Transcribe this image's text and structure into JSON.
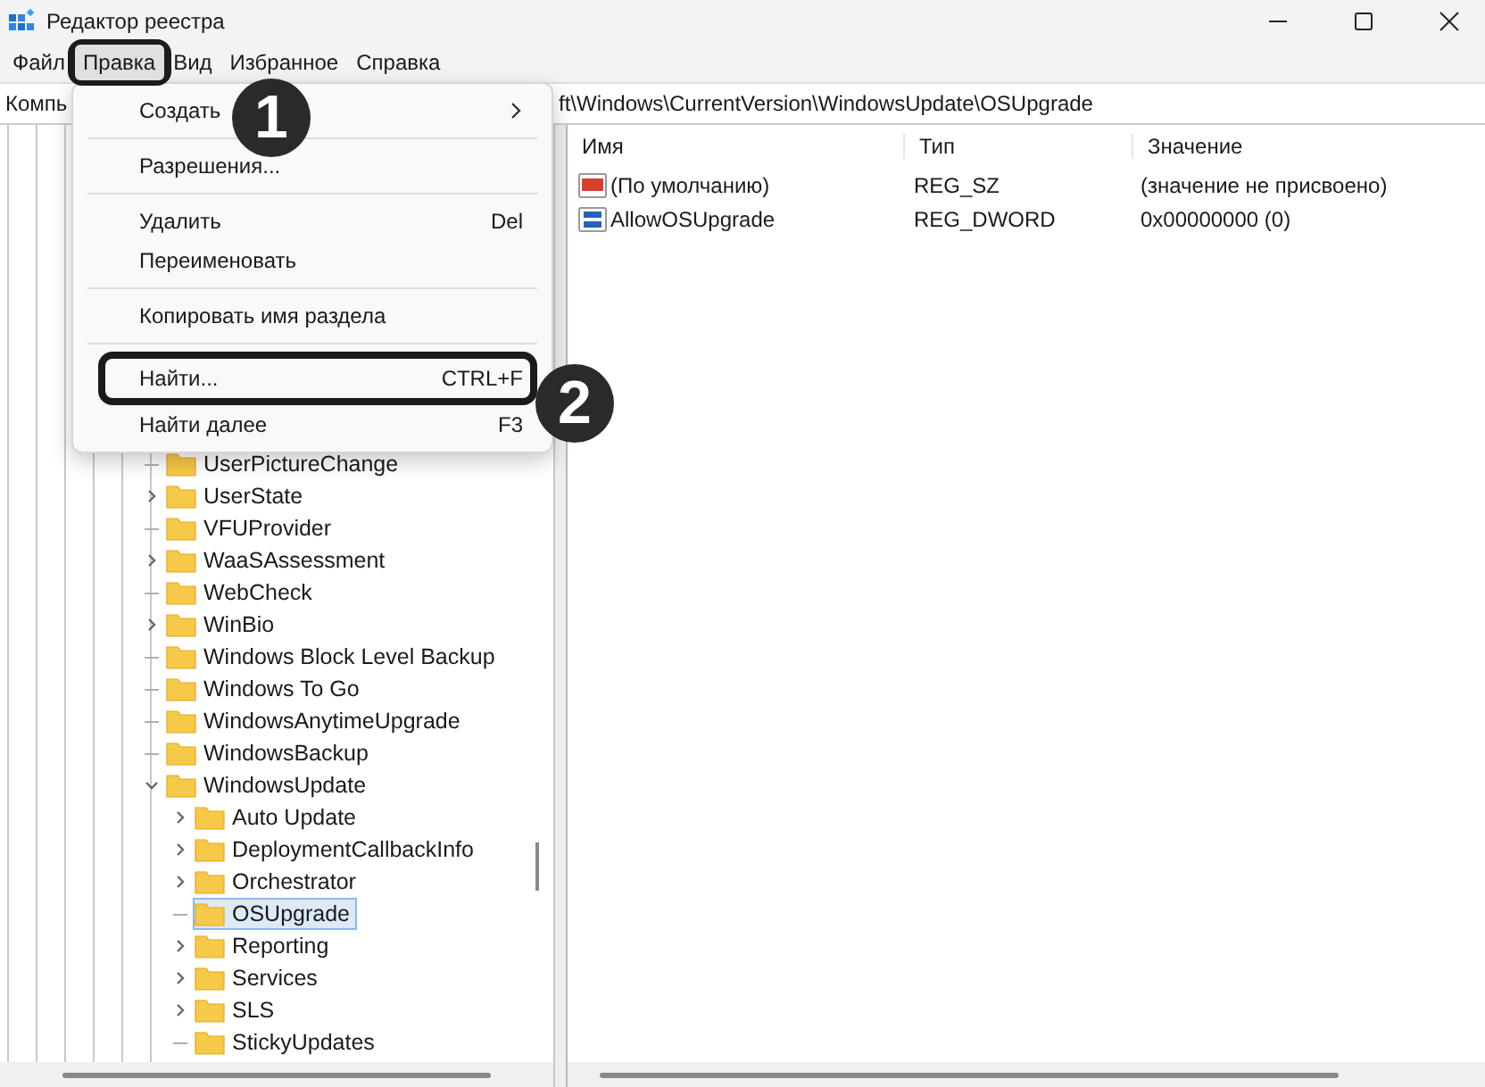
{
  "window": {
    "title": "Редактор реестра"
  },
  "menu_bar": [
    {
      "label": "Файл",
      "selected": false,
      "highlighted": false
    },
    {
      "label": "Правка",
      "selected": true,
      "highlighted": true
    },
    {
      "label": "Вид",
      "selected": false,
      "highlighted": false
    },
    {
      "label": "Избранное",
      "selected": false,
      "highlighted": false
    },
    {
      "label": "Справка",
      "selected": false,
      "highlighted": false
    }
  ],
  "address_bar": {
    "left_part": "Компь",
    "right_part": "ft\\Windows\\CurrentVersion\\WindowsUpdate\\OSUpgrade"
  },
  "tree": [
    {
      "label": "UserPictureChange",
      "has_children": false,
      "expanded": false,
      "selected": false
    },
    {
      "label": "UserState",
      "has_children": true,
      "expanded": false,
      "selected": false
    },
    {
      "label": "VFUProvider",
      "has_children": false,
      "expanded": false,
      "selected": false
    },
    {
      "label": "WaaSAssessment",
      "has_children": true,
      "expanded": false,
      "selected": false
    },
    {
      "label": "WebCheck",
      "has_children": false,
      "expanded": false,
      "selected": false
    },
    {
      "label": "WinBio",
      "has_children": true,
      "expanded": false,
      "selected": false
    },
    {
      "label": "Windows Block Level Backup",
      "has_children": false,
      "expanded": false,
      "selected": false
    },
    {
      "label": "Windows To Go",
      "has_children": false,
      "expanded": false,
      "selected": false
    },
    {
      "label": "WindowsAnytimeUpgrade",
      "has_children": false,
      "expanded": false,
      "selected": false
    },
    {
      "label": "WindowsBackup",
      "has_children": false,
      "expanded": false,
      "selected": false
    },
    {
      "label": "WindowsUpdate",
      "has_children": true,
      "expanded": true,
      "selected": false,
      "children": [
        {
          "label": "Auto Update",
          "has_children": true,
          "expanded": false,
          "selected": false
        },
        {
          "label": "DeploymentCallbackInfo",
          "has_children": true,
          "expanded": false,
          "selected": false
        },
        {
          "label": "Orchestrator",
          "has_children": true,
          "expanded": false,
          "selected": false
        },
        {
          "label": "OSUpgrade",
          "has_children": false,
          "expanded": false,
          "selected": true
        },
        {
          "label": "Reporting",
          "has_children": true,
          "expanded": false,
          "selected": false
        },
        {
          "label": "Services",
          "has_children": true,
          "expanded": false,
          "selected": false
        },
        {
          "label": "SLS",
          "has_children": true,
          "expanded": false,
          "selected": false
        },
        {
          "label": "StickyUpdates",
          "has_children": false,
          "expanded": false,
          "selected": false
        }
      ]
    }
  ],
  "values_table": {
    "columns": [
      "Имя",
      "Тип",
      "Значение"
    ],
    "rows": [
      {
        "kind": "string",
        "name": "(По умолчанию)",
        "type": "REG_SZ",
        "data": "(значение не присвоено)"
      },
      {
        "kind": "binary",
        "name": "AllowOSUpgrade",
        "type": "REG_DWORD",
        "data": "0x00000000 (0)"
      }
    ]
  },
  "edit_menu": [
    {
      "kind": "submenu",
      "label": "Создать",
      "highlighted": false
    },
    {
      "kind": "separator"
    },
    {
      "kind": "item",
      "label": "Разрешения...",
      "highlighted": false
    },
    {
      "kind": "separator"
    },
    {
      "kind": "item",
      "label": "Удалить",
      "shortcut": "Del",
      "highlighted": false
    },
    {
      "kind": "item",
      "label": "Переименовать",
      "highlighted": false
    },
    {
      "kind": "separator"
    },
    {
      "kind": "item",
      "label": "Копировать имя раздела",
      "highlighted": false
    },
    {
      "kind": "separator"
    },
    {
      "kind": "item",
      "label": "Найти...",
      "shortcut": "CTRL+F",
      "highlighted": true
    },
    {
      "kind": "item",
      "label": "Найти далее",
      "shortcut": "F3",
      "highlighted": false
    }
  ],
  "callouts": [
    {
      "number": "1"
    },
    {
      "number": "2"
    }
  ]
}
